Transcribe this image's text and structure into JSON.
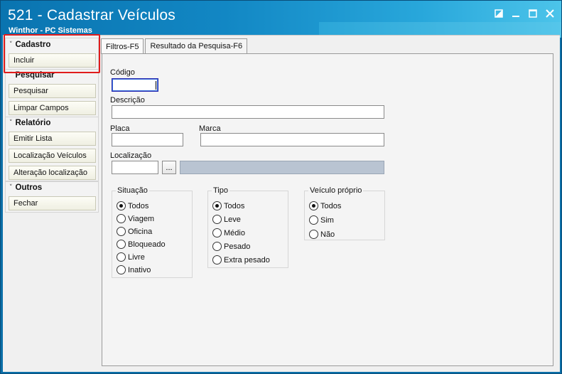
{
  "window": {
    "title": "521 - Cadastrar Veículos",
    "subtitle": "Winthor - PC Sistemas",
    "controls": [
      "restore-icon",
      "minimize-icon",
      "maximize-icon",
      "close-icon"
    ]
  },
  "sidebar": {
    "groups": [
      {
        "title": "Cadastro",
        "items": [
          {
            "label": "Incluir"
          }
        ]
      },
      {
        "title": "Pesquisar",
        "items": [
          {
            "label": "Pesquisar"
          },
          {
            "label": "Limpar Campos"
          }
        ]
      },
      {
        "title": "Relatório",
        "items": [
          {
            "label": "Emitir Lista"
          },
          {
            "label": "Localização Veículos"
          },
          {
            "label": "Alteração localização"
          }
        ]
      },
      {
        "title": "Outros",
        "items": [
          {
            "label": "Fechar"
          }
        ]
      }
    ]
  },
  "tabs": [
    {
      "label": "Filtros-F5",
      "active": true
    },
    {
      "label": "Resultado da Pesquisa-F6",
      "active": false
    }
  ],
  "form": {
    "codigo": {
      "label": "Código",
      "value": ""
    },
    "descricao": {
      "label": "Descrição",
      "value": ""
    },
    "placa": {
      "label": "Placa",
      "value": ""
    },
    "marca": {
      "label": "Marca",
      "value": ""
    },
    "localizacao": {
      "label": "Localização",
      "value": "",
      "button": "..."
    },
    "situacao": {
      "legend": "Situação",
      "options": [
        "Todos",
        "Viagem",
        "Oficina",
        "Bloqueado",
        "Livre",
        "Inativo"
      ],
      "selected": "Todos"
    },
    "tipo": {
      "legend": "Tipo",
      "options": [
        "Todos",
        "Leve",
        "Médio",
        "Pesado",
        "Extra pesado"
      ],
      "selected": "Todos"
    },
    "veiculo_proprio": {
      "legend": "Veículo próprio",
      "options": [
        "Todos",
        "Sim",
        "Não"
      ],
      "selected": "Todos"
    }
  },
  "colors": {
    "title_bar": "#1287c4",
    "highlight": "#e01c1c",
    "readonly_field": "#b9c4d2"
  }
}
